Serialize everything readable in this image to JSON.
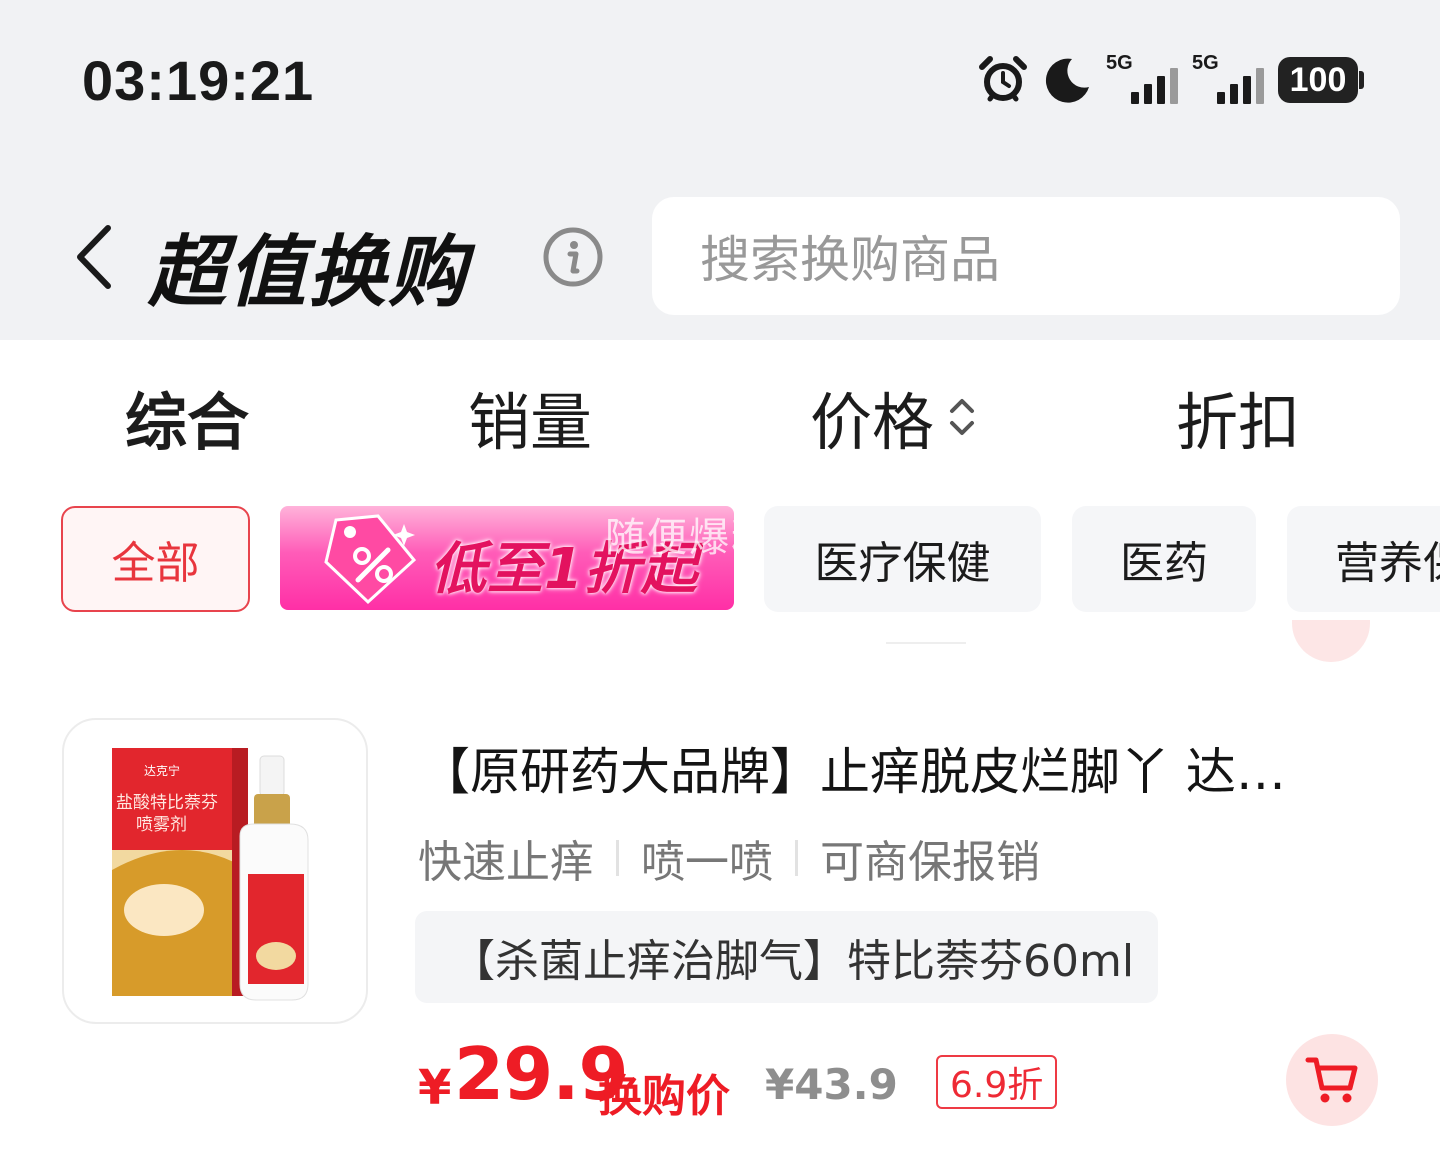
{
  "status_bar": {
    "time": "03:19:21",
    "battery": "100",
    "signal_1_label": "5G",
    "signal_2_label": "5G",
    "icons": [
      "alarm-icon",
      "moon-icon",
      "signal-icon",
      "signal-icon",
      "battery-icon"
    ]
  },
  "header": {
    "title": "超值换购",
    "search_placeholder": "搜索换购商品"
  },
  "sort_tabs": [
    {
      "label": "综合",
      "active": true
    },
    {
      "label": "销量",
      "active": false
    },
    {
      "label": "价格",
      "active": false
    },
    {
      "label": "折扣",
      "active": false
    }
  ],
  "filters": {
    "all": "全部",
    "promo": "低至1折起",
    "watermark": "随便爆料",
    "chips": [
      "医疗保健",
      "医药",
      "营养保健"
    ]
  },
  "product": {
    "title": "【原研药大品牌】止痒脱皮烂脚丫 达…",
    "features": [
      "快速止痒",
      "喷一喷",
      "可商保报销"
    ],
    "spec": "【杀菌止痒治脚气】特比萘芬60ml",
    "price_symbol": "¥",
    "price": "29.9",
    "price_label": "换购价",
    "original_price": "¥43.9",
    "discount": "6.9折",
    "image_texts": {
      "brand": "达克宁",
      "name_line1": "盐酸特比萘芬",
      "name_line2": "喷雾剂"
    }
  },
  "colors": {
    "accent": "#ee1c25",
    "background_top": "#f1f2f4",
    "chip_bg": "#f5f6f8"
  }
}
